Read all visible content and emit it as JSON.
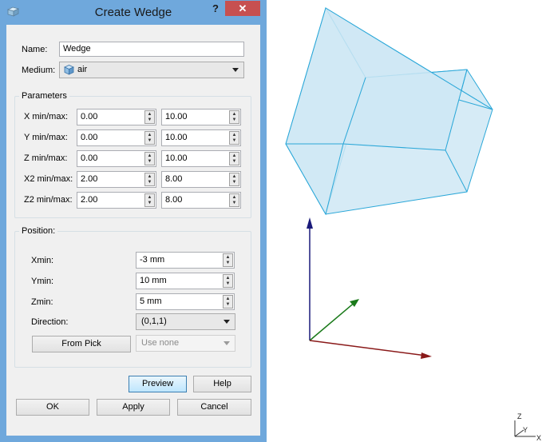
{
  "dialog": {
    "title": "Create Wedge",
    "help_symbol": "?",
    "close_symbol": "✕",
    "name_label": "Name:",
    "name_value": "Wedge",
    "medium_label": "Medium:",
    "medium_value": "air",
    "parameters_title": "Parameters",
    "params": [
      {
        "label": "X min/max:",
        "min": "0.00",
        "max": "10.00"
      },
      {
        "label": "Y min/max:",
        "min": "0.00",
        "max": "10.00"
      },
      {
        "label": "Z min/max:",
        "min": "0.00",
        "max": "10.00"
      },
      {
        "label": "X2 min/max:",
        "min": "2.00",
        "max": "8.00"
      },
      {
        "label": "Z2 min/max:",
        "min": "2.00",
        "max": "8.00"
      }
    ],
    "position_title": "Position:",
    "xmin_label": "Xmin:",
    "xmin_value": "-3 mm",
    "ymin_label": "Ymin:",
    "ymin_value": "10 mm",
    "zmin_label": "Zmin:",
    "zmin_value": "5 mm",
    "direction_label": "Direction:",
    "direction_value": "(0,1,1)",
    "from_pick_label": "From Pick",
    "use_none_label": "Use none",
    "preview_label": "Preview",
    "help_label": "Help",
    "ok_label": "OK",
    "apply_label": "Apply",
    "cancel_label": "Cancel"
  },
  "triad": {
    "z": "Z",
    "y": "Y",
    "x": "X"
  },
  "colors": {
    "title_bar": "#6fa8dc",
    "close_button": "#c75050",
    "wedge_fill": "#cfe8f4",
    "wedge_edge": "#2aa7d8",
    "axis_z": "#1a1a7a",
    "axis_y": "#1a7a1a",
    "axis_x": "#8a1a1a"
  }
}
